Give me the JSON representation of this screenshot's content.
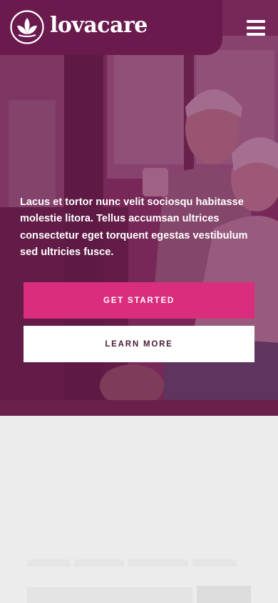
{
  "brand": {
    "name": "lovacare",
    "colors": {
      "primary": "#6b1a4e",
      "accent": "#db2d7d",
      "white": "#ffffff"
    }
  },
  "header": {
    "menu_icon": "hamburger-menu-icon"
  },
  "hero": {
    "text": "Lacus et tortor nunc velit sociosqu habitasse molestie litora. Tellus accumsan ultrices consectetur eget torquent egestas vestibulum sed ultricies fusce.",
    "primary_button": "GET STARTED",
    "secondary_button": "LEARN MORE"
  }
}
